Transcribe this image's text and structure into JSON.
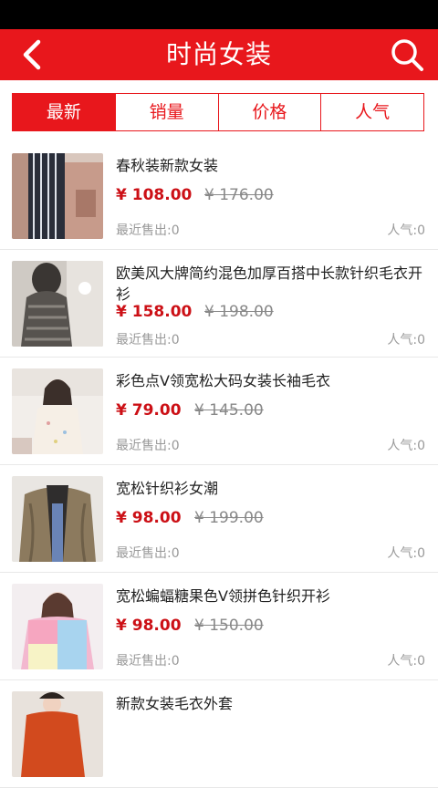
{
  "header": {
    "title": "时尚女装",
    "back_icon": "chevron-left-icon",
    "search_icon": "search-icon",
    "bg_color": "#e8171c"
  },
  "tabs": [
    {
      "label": "最新",
      "active": true
    },
    {
      "label": "销量",
      "active": false
    },
    {
      "label": "价格",
      "active": false
    },
    {
      "label": "人气",
      "active": false
    }
  ],
  "products": [
    {
      "title": "春秋装新款女装",
      "price": "¥ 108.00",
      "old_price": "¥ 176.00",
      "sold": "最近售出:0",
      "popularity": "人气:0"
    },
    {
      "title": "欧美风大牌简约混色加厚百搭中长款针织毛衣开衫",
      "price": "¥ 158.00",
      "old_price": "¥ 198.00",
      "sold": "最近售出:0",
      "popularity": "人气:0"
    },
    {
      "title": " 彩色点V领宽松大码女装长袖毛衣",
      "price": "¥ 79.00",
      "old_price": "¥ 145.00",
      "sold": "最近售出:0",
      "popularity": "人气:0"
    },
    {
      "title": "宽松针织衫女潮",
      "price": "¥ 98.00",
      "old_price": "¥ 199.00",
      "sold": "最近售出:0",
      "popularity": "人气:0"
    },
    {
      "title": "宽松蝙蝠糖果色V领拼色针织开衫",
      "price": "¥ 98.00",
      "old_price": "¥ 150.00",
      "sold": "最近售出:0",
      "popularity": "人气:0"
    },
    {
      "title": "新款女装毛衣外套"
    }
  ]
}
